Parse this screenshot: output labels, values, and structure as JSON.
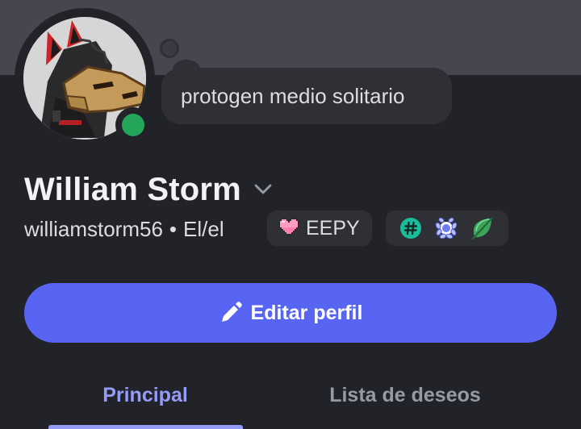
{
  "profile": {
    "custom_status": "protogen medio solitario",
    "display_name": "William Storm",
    "username": "williamstorm56",
    "separator": "•",
    "pronouns": "El/el",
    "online_status": "online",
    "online_color": "#23a55a"
  },
  "tag": {
    "icon": "pixel-heart-icon",
    "label": "EEPY"
  },
  "badges": [
    {
      "icon": "hashtag-badge-icon",
      "color": "#1abc9c"
    },
    {
      "icon": "laurel-badge-icon",
      "color": "#6d7bf0"
    },
    {
      "icon": "leaf-badge-icon",
      "color": "#3ba55c"
    }
  ],
  "actions": {
    "edit_label": "Editar perfil",
    "edit_icon": "pencil-icon",
    "accent": "#5865f2"
  },
  "tabs": [
    {
      "label": "Principal",
      "active": true
    },
    {
      "label": "Lista de deseos",
      "active": false
    }
  ]
}
